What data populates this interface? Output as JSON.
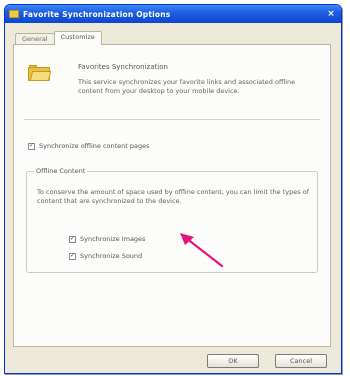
{
  "window": {
    "title": "Favorite Synchronization Options"
  },
  "tabs": [
    {
      "label": "General"
    },
    {
      "label": "Customize"
    }
  ],
  "intro": {
    "heading": "Favorites Synchronization",
    "description": "This service synchronizes your favorite links and associated offline content from your desktop to your mobile device."
  },
  "sync_offline": {
    "label": "Synchronize offline content pages",
    "checked": true
  },
  "offline_content": {
    "title": "Offline Content",
    "description": "To conserve the amount of space used by offline content, you can limit the types of content that are synchronized to the device.",
    "options": [
      {
        "label": "Synchronize Images",
        "checked": true
      },
      {
        "label": "Synchronize Sound",
        "checked": true
      }
    ]
  },
  "buttons": {
    "ok": "OK",
    "cancel": "Cancel"
  },
  "annotation": {
    "arrow_color": "#e8137a"
  }
}
